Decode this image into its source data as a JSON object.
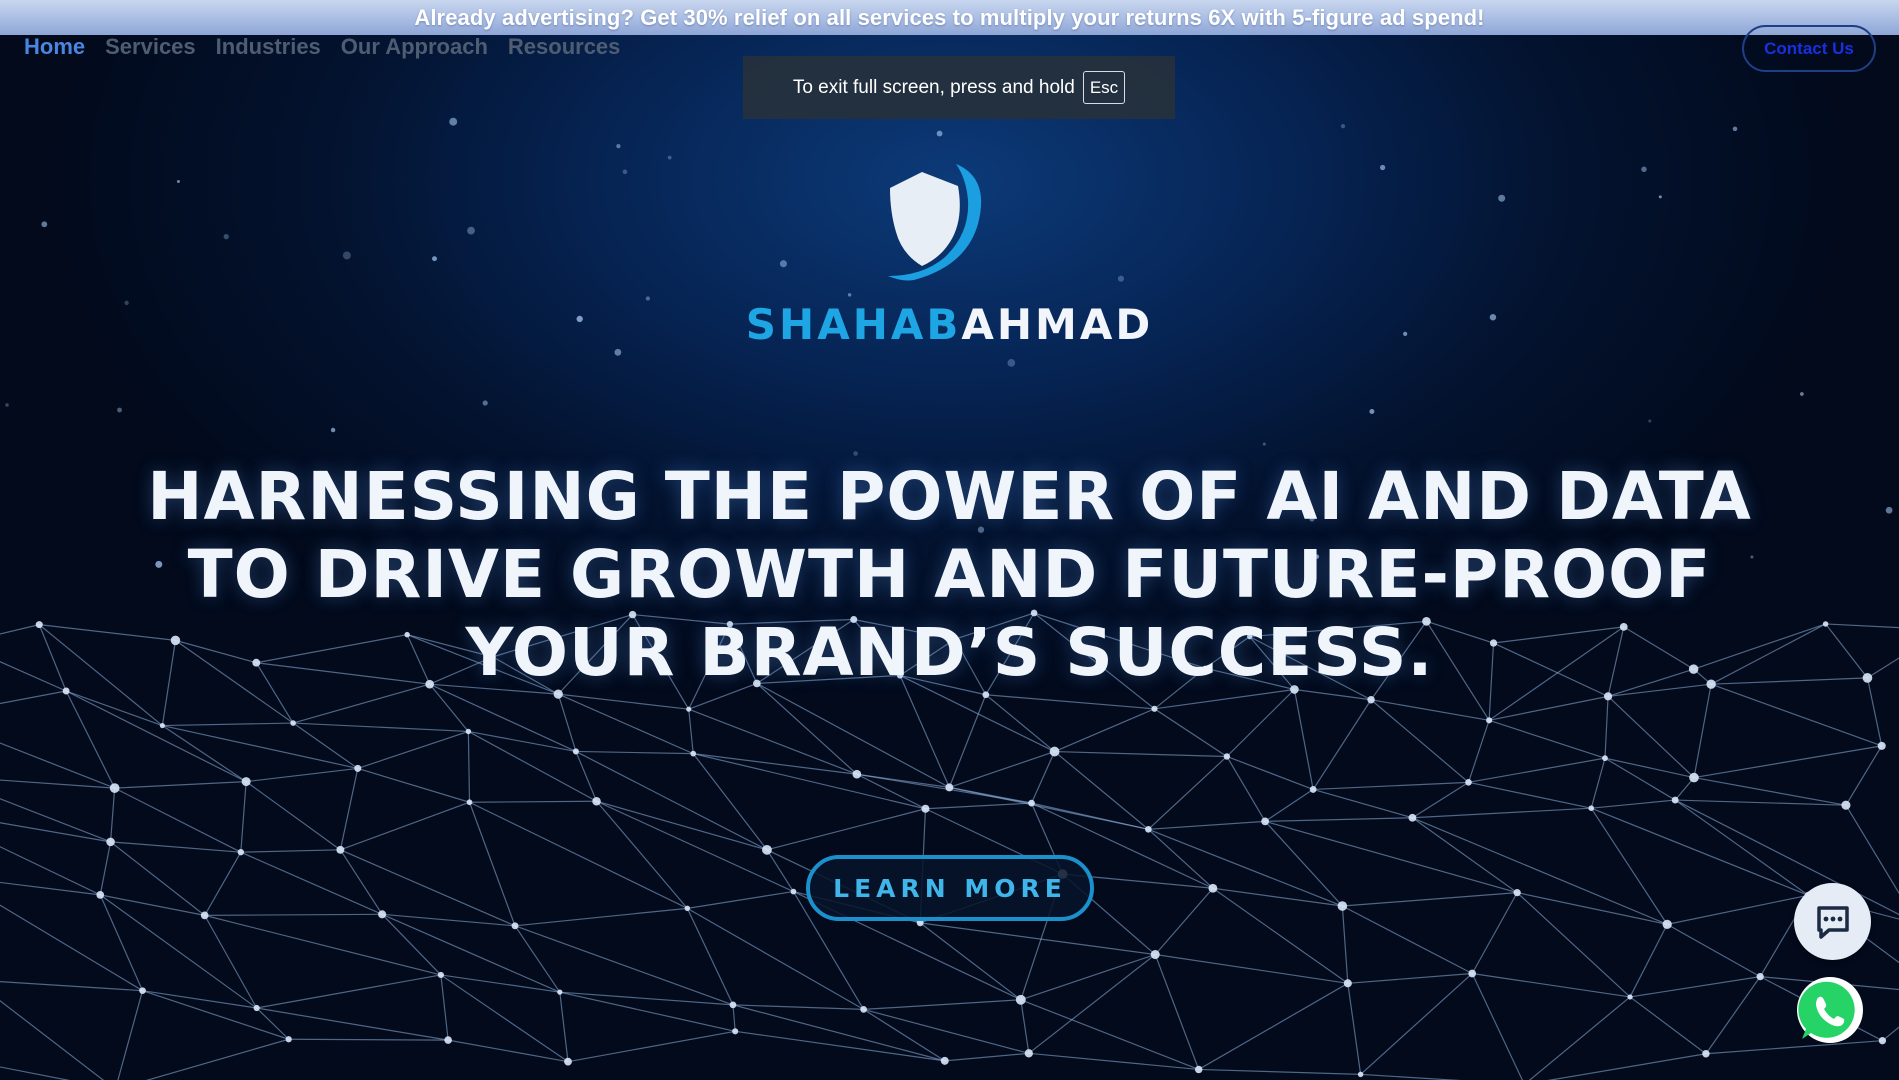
{
  "promo": {
    "text": "Already advertising? Get 30% relief on all services to multiply your returns 6X with 5-figure ad spend!"
  },
  "nav": {
    "items": [
      {
        "label": "Home",
        "active": true
      },
      {
        "label": "Services",
        "active": false
      },
      {
        "label": "Industries",
        "active": false
      },
      {
        "label": "Our Approach",
        "active": false
      },
      {
        "label": "Resources",
        "active": false
      }
    ],
    "contact_label": "Contact Us"
  },
  "fullscreen_toast": {
    "text": "To exit full screen, press and hold",
    "key": "Esc"
  },
  "brand": {
    "first": "SHAHAB",
    "last": "AHMAD",
    "logo_icon": "shield-swoosh-icon"
  },
  "hero": {
    "headline_lines": [
      "HARNESSING THE POWER OF AI AND DATA",
      "TO DRIVE GROWTH AND FUTURE-PROOF",
      "YOUR BRAND’S SUCCESS."
    ],
    "cta_label": "LEARN MORE"
  },
  "floating": {
    "chat_icon": "chat-bubble-icon",
    "whatsapp_icon": "whatsapp-icon"
  },
  "colors": {
    "accent": "#1ea6e4",
    "nav_active": "#4a86e0",
    "nav_inactive": "#4f5d73",
    "background": "#020a1c",
    "whatsapp": "#25d366"
  }
}
